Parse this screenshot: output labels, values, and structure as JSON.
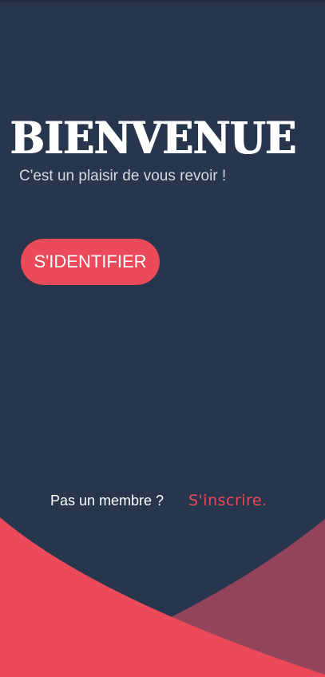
{
  "welcome": {
    "title": "BIENVENUE",
    "subtitle": "C'est un plaisir de vous revoir !"
  },
  "actions": {
    "login_label": "S'IDENTIFIER"
  },
  "footer": {
    "not_member_text": "Pas un membre ?",
    "signup_label": "S'inscrire."
  },
  "colors": {
    "background": "#27364d",
    "accent": "#ea4a5a",
    "accent_dark": "#93435a",
    "text_primary": "#ffffff"
  }
}
